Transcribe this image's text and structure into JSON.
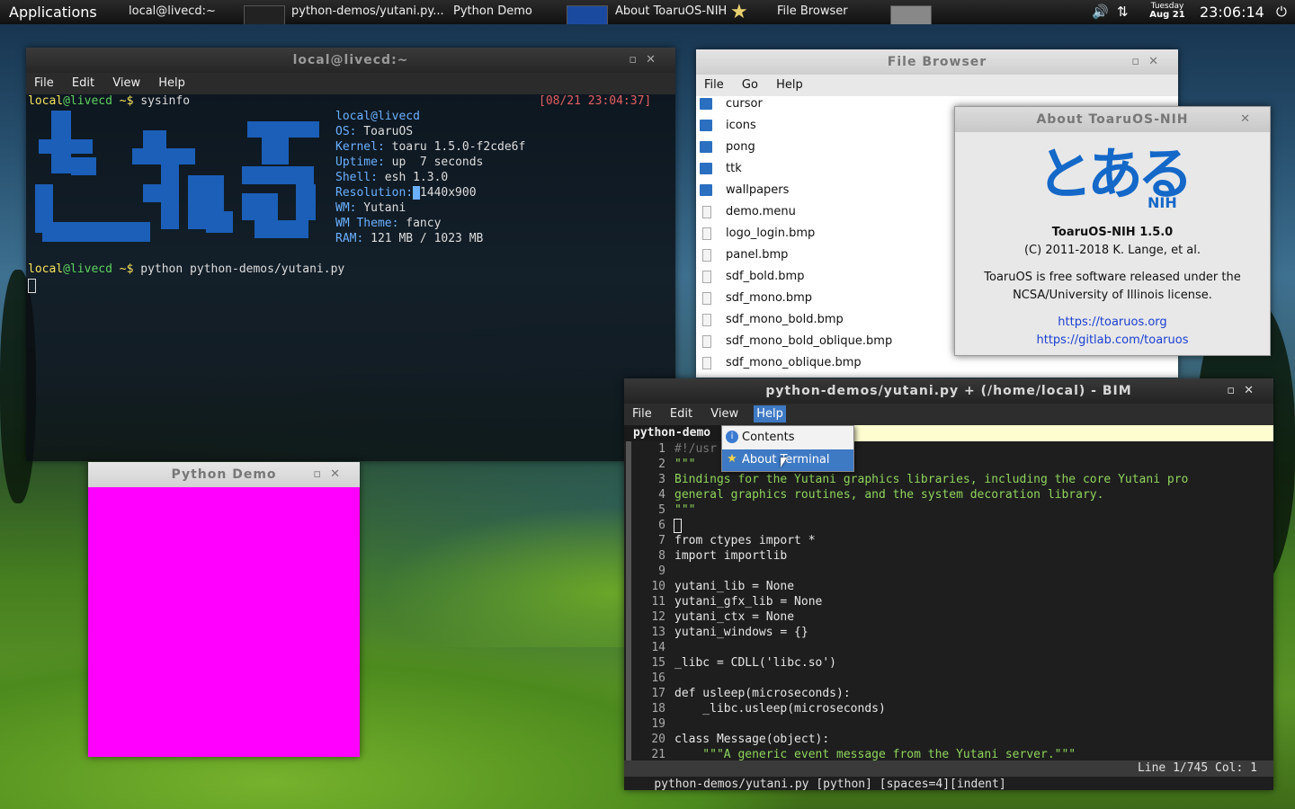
{
  "panel": {
    "apps_label": "Applications",
    "tasks": [
      {
        "label": "local@livecd:~"
      },
      {
        "label": "python-demos/yutani.py..."
      },
      {
        "label": "Python Demo"
      },
      {
        "label": "About ToaruOS-NIH"
      },
      {
        "label": "File Browser"
      }
    ],
    "date_day": "Tuesday",
    "date_md": "Aug 21",
    "clock": "23:06:14",
    "icons": [
      "volume-icon",
      "network-icon",
      "power-icon"
    ]
  },
  "terminal": {
    "title": "local@livecd:~",
    "menu": [
      "File",
      "Edit",
      "View",
      "Help"
    ],
    "prompt_user": "local",
    "prompt_host": "@livecd",
    "prompt_rest": " ~$ ",
    "cmd1": "sysinfo",
    "timestamp": "[08/21 23:04:37]",
    "sysinfo": [
      {
        "key": "local@livecd",
        "val": ""
      },
      {
        "key": "OS:",
        "val": " ToaruOS"
      },
      {
        "key": "Kernel:",
        "val": " toaru 1.5.0-f2cde6f"
      },
      {
        "key": "Uptime:",
        "val": " up  7 seconds"
      },
      {
        "key": "Shell:",
        "val": " esh 1.3.0"
      },
      {
        "key": "Resolution:",
        "val": "1440x900"
      },
      {
        "key": "WM:",
        "val": " Yutani"
      },
      {
        "key": "WM Theme:",
        "val": " fancy"
      },
      {
        "key": "RAM:",
        "val": " 121 MB / 1023 MB"
      }
    ],
    "cmd2": "python python-demos/yutani.py"
  },
  "file_browser": {
    "title": "File Browser",
    "menu": [
      "File",
      "Go",
      "Help"
    ],
    "items": [
      {
        "name": "cursor",
        "type": "folder"
      },
      {
        "name": "icons",
        "type": "folder"
      },
      {
        "name": "pong",
        "type": "folder"
      },
      {
        "name": "ttk",
        "type": "folder"
      },
      {
        "name": "wallpapers",
        "type": "folder"
      },
      {
        "name": "demo.menu",
        "type": "file"
      },
      {
        "name": "logo_login.bmp",
        "type": "file"
      },
      {
        "name": "panel.bmp",
        "type": "file"
      },
      {
        "name": "sdf_bold.bmp",
        "type": "file"
      },
      {
        "name": "sdf_mono.bmp",
        "type": "file"
      },
      {
        "name": "sdf_mono_bold.bmp",
        "type": "file"
      },
      {
        "name": "sdf_mono_bold_oblique.bmp",
        "type": "file"
      },
      {
        "name": "sdf_mono_oblique.bmp",
        "type": "file"
      }
    ]
  },
  "about": {
    "title": "About ToaruOS-NIH",
    "logo_text": "とある",
    "logo_sub": "NIH",
    "version": "ToaruOS-NIH 1.5.0",
    "copyright": "(C) 2011-2018 K. Lange, et al.",
    "license_line1": "ToaruOS is free software released under the",
    "license_line2": "NCSA/University of Illinois license.",
    "link1": "https://toaruos.org",
    "link2": "https://gitlab.com/toaruos"
  },
  "python_demo": {
    "title": "Python Demo",
    "fill_color": "#ff00ff"
  },
  "editor": {
    "title": "python-demos/yutani.py + (/home/local) - BIM",
    "menu": [
      "File",
      "Edit",
      "View",
      "Help"
    ],
    "tab": "python-demo",
    "help_menu": {
      "items": [
        "Contents",
        "About Terminal"
      ]
    },
    "lines": [
      {
        "n": "1",
        "t": "#!/usr",
        "c": "c-cm"
      },
      {
        "n": "2",
        "t": "\"\"\"",
        "c": "c-str"
      },
      {
        "n": "3",
        "t": "Bindings for the Yutani graphics libraries, including the core Yutani pro",
        "c": "c-str"
      },
      {
        "n": "4",
        "t": "general graphics routines, and the system decoration library.",
        "c": "c-str"
      },
      {
        "n": "5",
        "t": "\"\"\"",
        "c": "c-str"
      },
      {
        "n": "6",
        "t": "",
        "c": "c-txt"
      },
      {
        "n": "7",
        "t": "from ctypes import *",
        "c": "c-txt"
      },
      {
        "n": "8",
        "t": "import importlib",
        "c": "c-txt"
      },
      {
        "n": "9",
        "t": "",
        "c": "c-txt"
      },
      {
        "n": "10",
        "t": "yutani_lib = None",
        "c": "c-txt"
      },
      {
        "n": "11",
        "t": "yutani_gfx_lib = None",
        "c": "c-txt"
      },
      {
        "n": "12",
        "t": "yutani_ctx = None",
        "c": "c-txt"
      },
      {
        "n": "13",
        "t": "yutani_windows = {}",
        "c": "c-txt"
      },
      {
        "n": "14",
        "t": "",
        "c": "c-txt"
      },
      {
        "n": "15",
        "t": "_libc = CDLL('libc.so')",
        "c": "c-txt"
      },
      {
        "n": "16",
        "t": "",
        "c": "c-txt"
      },
      {
        "n": "17",
        "t": "def usleep(microseconds):",
        "c": "c-txt"
      },
      {
        "n": "18",
        "t": "    _libc.usleep(microseconds)",
        "c": "c-txt"
      },
      {
        "n": "19",
        "t": "",
        "c": "c-txt"
      },
      {
        "n": "20",
        "t": "class Message(object):",
        "c": "c-txt"
      },
      {
        "n": "21",
        "t": "    \"\"\"A generic event message from the Yutani server.\"\"\"",
        "c": "c-str"
      }
    ],
    "status_left": "python-demos/yutani.py [python] [spaces=4][indent]",
    "status_right": "Line 1/745 Col: 1"
  }
}
